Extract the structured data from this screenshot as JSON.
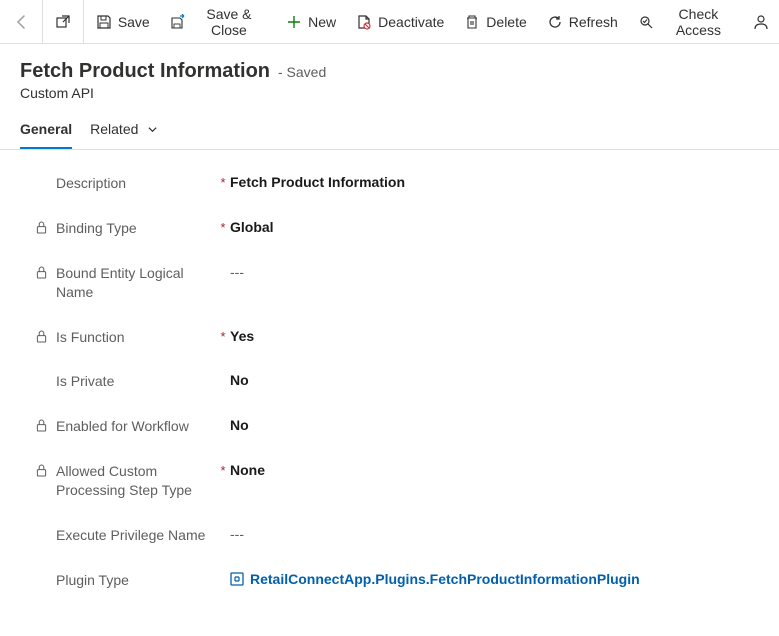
{
  "toolbar": {
    "save": "Save",
    "saveClose": "Save & Close",
    "new": "New",
    "deactivate": "Deactivate",
    "delete": "Delete",
    "refresh": "Refresh",
    "checkAccess": "Check Access"
  },
  "header": {
    "title": "Fetch Product Information",
    "status": "- Saved",
    "subtitle": "Custom API"
  },
  "tabs": {
    "general": "General",
    "related": "Related"
  },
  "fields": {
    "description": {
      "label": "Description",
      "value": "Fetch Product Information"
    },
    "bindingType": {
      "label": "Binding Type",
      "value": "Global"
    },
    "boundEntity": {
      "label": "Bound Entity Logical Name",
      "value": "---"
    },
    "isFunction": {
      "label": "Is Function",
      "value": "Yes"
    },
    "isPrivate": {
      "label": "Is Private",
      "value": "No"
    },
    "enabledForWorkflow": {
      "label": "Enabled for Workflow",
      "value": "No"
    },
    "allowedStepType": {
      "label": "Allowed Custom Processing Step Type",
      "value": "None"
    },
    "executePrivilege": {
      "label": "Execute Privilege Name",
      "value": "---"
    },
    "pluginType": {
      "label": "Plugin Type",
      "value": "RetailConnectApp.Plugins.FetchProductInformationPlugin"
    }
  }
}
